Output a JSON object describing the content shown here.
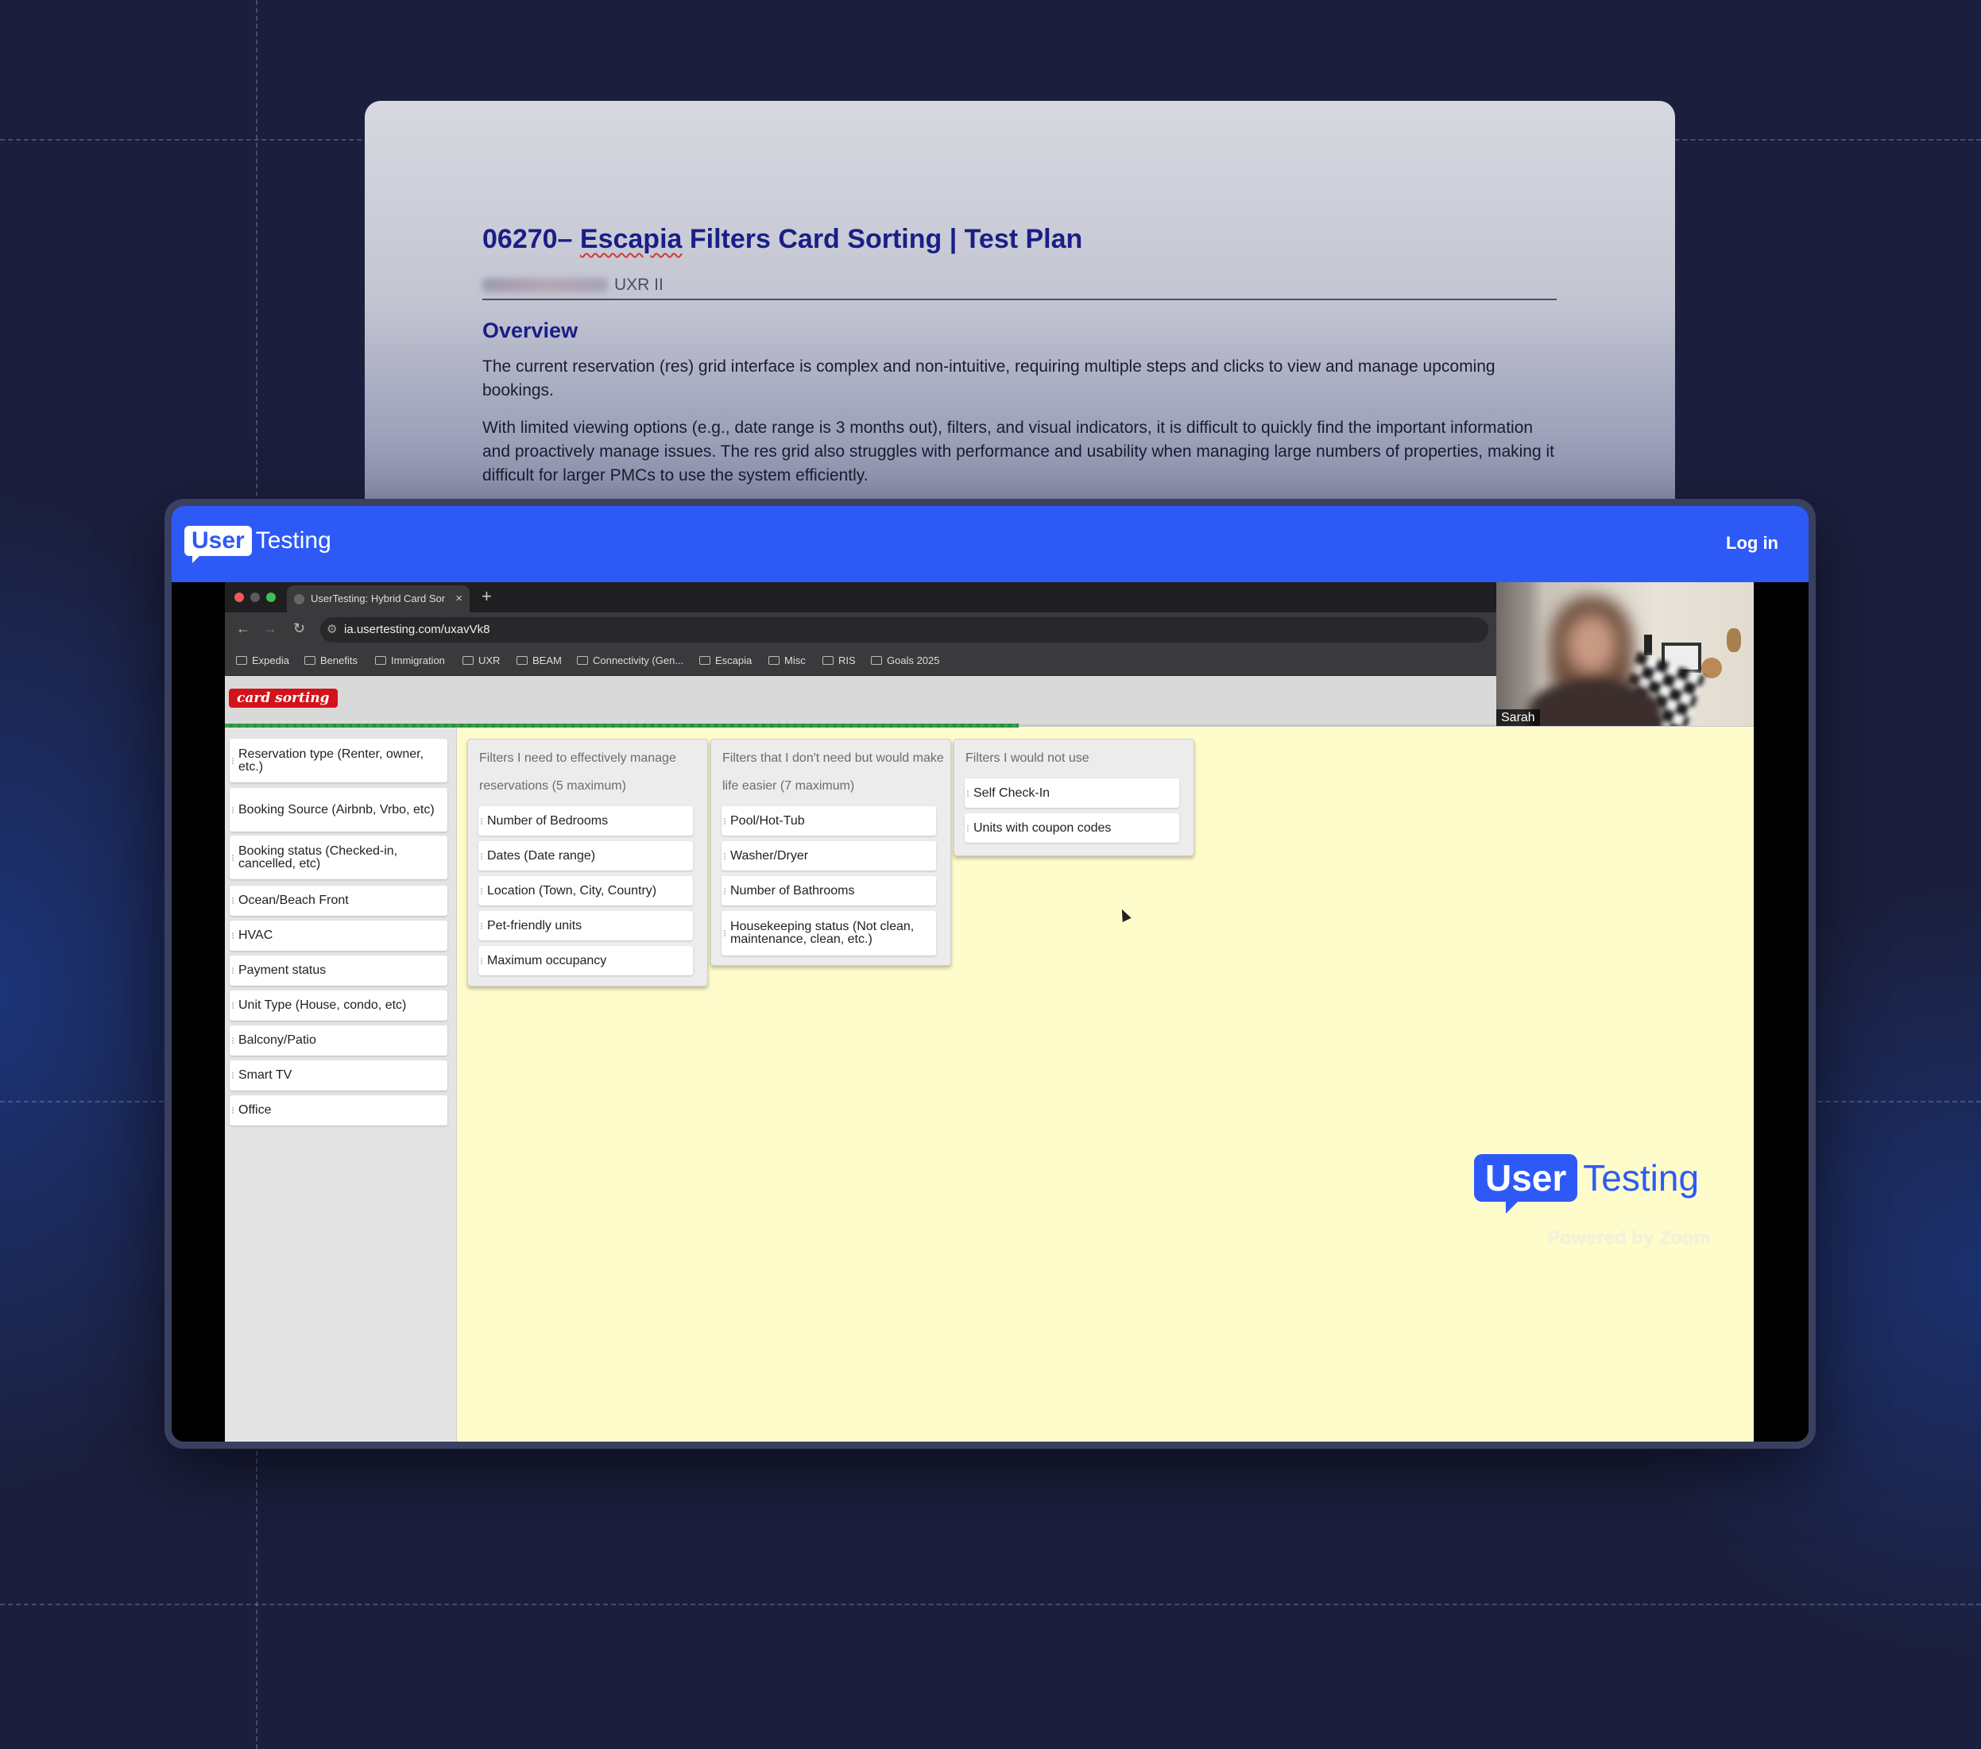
{
  "document": {
    "title_prefix": "06270– ",
    "title_underlined": "Escapia",
    "title_suffix": " Filters Card Sorting | Test Plan",
    "author_role": "UXR II",
    "overview_heading": "Overview",
    "paragraph_1": "The current reservation (res) grid interface is complex and non-intuitive, requiring multiple steps and clicks to view and manage upcoming bookings.",
    "paragraph_2": "With limited viewing options (e.g., date range is 3 months out), filters, and visual indicators, it is difficult to quickly find the important information and proactively manage issues. The res grid also struggles with performance and usability when managing large numbers of properties, making it difficult for larger PMCs to use the system efficiently."
  },
  "usertesting": {
    "logo_user": "User",
    "logo_testing": "Testing",
    "login_label": "Log in",
    "watermark_user": "User",
    "watermark_testing": "Testing",
    "watermark_powered": "Powered by Zoom"
  },
  "browser": {
    "tab_title": "UserTesting: Hybrid Card Sor",
    "tab_close": "×",
    "new_tab": "+",
    "url": "ia.usertesting.com/uxavVk8",
    "bookmarks": [
      "Expedia",
      "Benefits",
      "Immigration",
      "UXR",
      "BEAM",
      "Connectivity (Gen...",
      "Escapia",
      "Misc",
      "RIS",
      "Goals 2025"
    ]
  },
  "card_sorting": {
    "badge": "card sorting",
    "progress_fraction": 0.52,
    "unsorted_cards": [
      "Reservation type (Renter, owner, etc.)",
      "Booking Source (Airbnb, Vrbo, etc)",
      "Booking status (Checked-in, cancelled, etc)",
      "Ocean/Beach Front",
      "HVAC",
      "Payment status",
      "Unit Type (House, condo, etc)",
      "Balcony/Patio",
      "Smart TV",
      "Office"
    ],
    "groups": [
      {
        "title": "Filters I need to effectively manage reservations (5 maximum)",
        "cards": [
          "Number of Bedrooms",
          "Dates (Date range)",
          "Location (Town, City, Country)",
          "Pet-friendly units",
          "Maximum occupancy"
        ]
      },
      {
        "title": "Filters that I don't need but would make life easier (7 maximum)",
        "cards": [
          "Pool/Hot-Tub",
          "Washer/Dryer",
          "Number of Bathrooms",
          "Housekeeping status (Not clean, maintenance, clean, etc.)"
        ]
      },
      {
        "title": "Filters I would not use",
        "cards": [
          "Self Check-In",
          "Units with coupon codes"
        ]
      }
    ]
  },
  "webcam": {
    "participant_name": "Sarah"
  },
  "colors": {
    "accent": "#2d5af7",
    "doc_heading": "#1a1e86",
    "badge_red": "#d3121a",
    "board_bg": "#fffccc",
    "progress_green": "#36a24a"
  }
}
